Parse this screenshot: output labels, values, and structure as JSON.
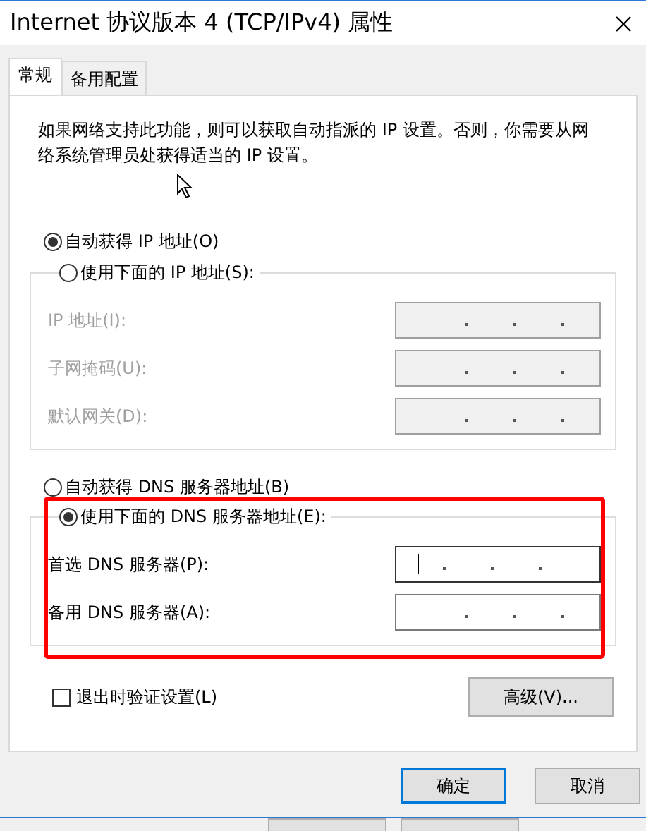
{
  "window": {
    "title": "Internet 协议版本 4 (TCP/IPv4) 属性"
  },
  "tabs": [
    {
      "label": "常规",
      "selected": true
    },
    {
      "label": "备用配置",
      "selected": false
    }
  ],
  "description": "如果网络支持此功能，则可以获取自动指派的 IP 设置。否则，你需要从网络系统管理员处获得适当的 IP 设置。",
  "ip_mode": [
    {
      "label": "自动获得 IP 地址(O)",
      "selected": true
    },
    {
      "label": "使用下面的 IP 地址(S):",
      "selected": false
    }
  ],
  "ip_fields": [
    {
      "label": "IP 地址(I):",
      "disabled": true,
      "focused": false
    },
    {
      "label": "子网掩码(U):",
      "disabled": true,
      "focused": false
    },
    {
      "label": "默认网关(D):",
      "disabled": true,
      "focused": false
    }
  ],
  "dns_mode": [
    {
      "label": "自动获得 DNS 服务器地址(B)",
      "selected": false
    },
    {
      "label": "使用下面的 DNS 服务器地址(E):",
      "selected": true
    }
  ],
  "dns_fields": [
    {
      "label": "首选 DNS 服务器(P):",
      "disabled": false,
      "focused": true
    },
    {
      "label": "备用 DNS 服务器(A):",
      "disabled": false,
      "focused": false
    }
  ],
  "validate_on_exit": {
    "label": "退出时验证设置(L)",
    "checked": false
  },
  "advanced_button": "高级(V)...",
  "buttons": [
    {
      "label": "确定",
      "default": true
    },
    {
      "label": "取消",
      "default": false
    }
  ]
}
